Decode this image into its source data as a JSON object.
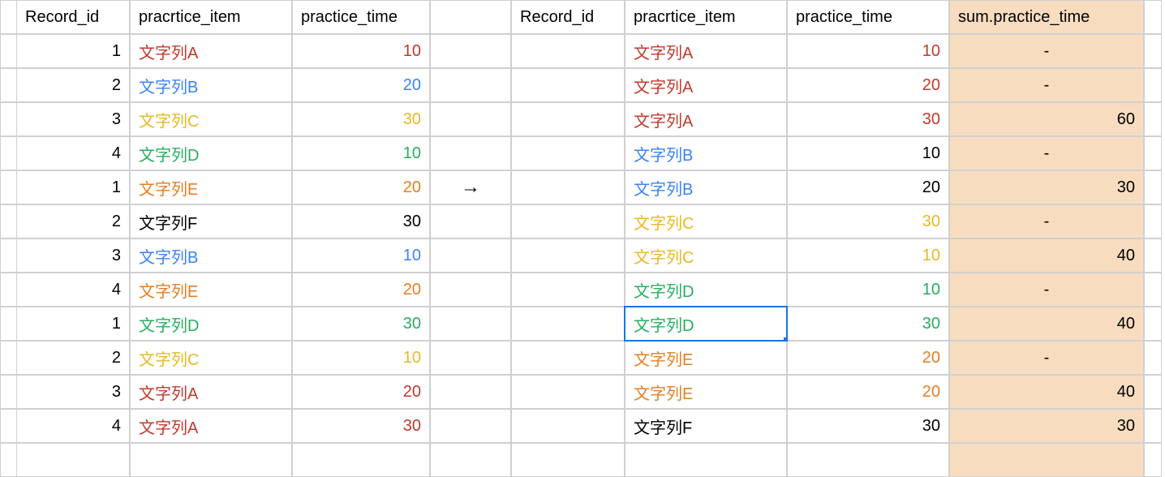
{
  "headers": {
    "left": {
      "c1": "Record_id",
      "c2": "pracrtice_item",
      "c3": "practice_time"
    },
    "right": {
      "c1": "Record_id",
      "c2": "pracrtice_item",
      "c3": "practice_time",
      "c4": "sum.practice_time"
    }
  },
  "arrow": "→",
  "colors": {
    "A": "c-red",
    "B": "c-blue",
    "C": "c-gold",
    "D": "c-green",
    "E": "c-orange",
    "F": "c-black"
  },
  "left_rows": [
    {
      "id": "1",
      "item": "文字列A",
      "time": "10",
      "ck": "A"
    },
    {
      "id": "2",
      "item": "文字列B",
      "time": "20",
      "ck": "B"
    },
    {
      "id": "3",
      "item": "文字列C",
      "time": "30",
      "ck": "C"
    },
    {
      "id": "4",
      "item": "文字列D",
      "time": "10",
      "ck": "D"
    },
    {
      "id": "1",
      "item": "文字列E",
      "time": "20",
      "ck": "E"
    },
    {
      "id": "2",
      "item": "文字列F",
      "time": "30",
      "ck": "F"
    },
    {
      "id": "3",
      "item": "文字列B",
      "time": "10",
      "ck": "B"
    },
    {
      "id": "4",
      "item": "文字列E",
      "time": "20",
      "ck": "E"
    },
    {
      "id": "1",
      "item": "文字列D",
      "time": "30",
      "ck": "D"
    },
    {
      "id": "2",
      "item": "文字列C",
      "time": "10",
      "ck": "C"
    },
    {
      "id": "3",
      "item": "文字列A",
      "time": "20",
      "ck": "A"
    },
    {
      "id": "4",
      "item": "文字列A",
      "time": "30",
      "ck": "A"
    }
  ],
  "right_rows": [
    {
      "id": "",
      "item": "文字列A",
      "time": "10",
      "ck": "A",
      "sum": "-",
      "sumnum": false
    },
    {
      "id": "",
      "item": "文字列A",
      "time": "20",
      "ck": "A",
      "sum": "-",
      "sumnum": false
    },
    {
      "id": "",
      "item": "文字列A",
      "time": "30",
      "ck": "A",
      "sum": "60",
      "sumnum": true
    },
    {
      "id": "",
      "item": "文字列B",
      "time": "10",
      "ck": "B",
      "sum": "-",
      "sumnum": false,
      "timeblack": true
    },
    {
      "id": "",
      "item": "文字列B",
      "time": "20",
      "ck": "B",
      "sum": "30",
      "sumnum": true,
      "timeblack": true
    },
    {
      "id": "",
      "item": "文字列C",
      "time": "30",
      "ck": "C",
      "sum": "-",
      "sumnum": false
    },
    {
      "id": "",
      "item": "文字列C",
      "time": "10",
      "ck": "C",
      "sum": "40",
      "sumnum": true
    },
    {
      "id": "",
      "item": "文字列D",
      "time": "10",
      "ck": "D",
      "sum": "-",
      "sumnum": false
    },
    {
      "id": "",
      "item": "文字列D",
      "time": "30",
      "ck": "D",
      "sum": "40",
      "sumnum": true,
      "selected": true
    },
    {
      "id": "",
      "item": "文字列E",
      "time": "20",
      "ck": "E",
      "sum": "-",
      "sumnum": false
    },
    {
      "id": "",
      "item": "文字列E",
      "time": "20",
      "ck": "E",
      "sum": "40",
      "sumnum": true
    },
    {
      "id": "",
      "item": "文字列F",
      "time": "30",
      "ck": "F",
      "sum": "30",
      "sumnum": true,
      "timeblack": true
    }
  ],
  "selected_cell": {
    "right_row_index": 8,
    "column": "item"
  }
}
